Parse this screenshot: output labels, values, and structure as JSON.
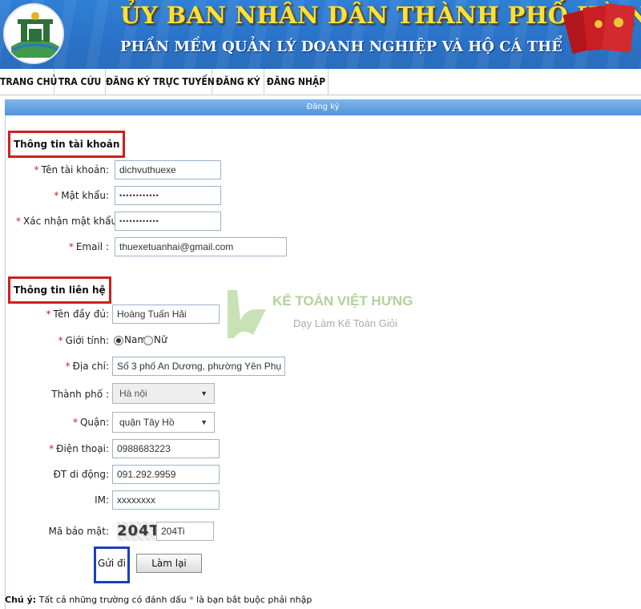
{
  "header": {
    "title": "ỦY BAN NHÂN DÂN THÀNH PHỐ HÀ NỘI",
    "subtitle": "PHẦN MỀM QUẢN LÝ DOANH NGHIỆP VÀ HỘ CÁ THỂ"
  },
  "nav": {
    "items": [
      {
        "label": "TRANG CHỦ"
      },
      {
        "label": "TRA CỨU"
      },
      {
        "label": "ĐĂNG KÝ TRỰC TUYẾN"
      },
      {
        "label": "ĐĂNG KÝ"
      },
      {
        "label": "ĐĂNG NHẬP"
      }
    ]
  },
  "section_title": "Đăng ký",
  "account": {
    "heading": "Thông tin tài khoản",
    "username": {
      "label": "Tên tài khoản:",
      "value": "dichvuthuexe"
    },
    "password": {
      "label": "Mật khẩu:",
      "value": "••••••••••••"
    },
    "confirm_password": {
      "label": "Xác nhận mật khẩu:",
      "value": "••••••••••••"
    },
    "email": {
      "label": "Email :",
      "value": "thuexetuanhai@gmail.com"
    }
  },
  "contact": {
    "heading": "Thông tin liên hệ",
    "fullname": {
      "label": "Tên đầy đủ:",
      "value": "Hoàng Tuấn Hải"
    },
    "gender": {
      "label": "Giới tính:",
      "options": [
        "Nam",
        "Nữ"
      ],
      "selected": "Nam"
    },
    "address": {
      "label": "Địa chỉ:",
      "value": "Số 3 phố An Dương, phường Yên Phụ"
    },
    "city": {
      "label": "Thành phố :",
      "value": "Hà nội"
    },
    "district": {
      "label": "Quận:",
      "value": "quận Tây Hồ"
    },
    "phone": {
      "label": "Điện thoại:",
      "value": "0988683223"
    },
    "office_phone": {
      "label": "ĐT di động:",
      "value": "091.292.9959"
    },
    "im": {
      "label": "IM:",
      "value": "xxxxxxxx"
    },
    "captcha": {
      "label": "Mã bảo mật:",
      "image_text": "204Ti",
      "value": "204Ti"
    }
  },
  "buttons": {
    "submit": "Gửi đi",
    "reset": "Làm lại"
  },
  "note": {
    "prefix": "Chú ý:",
    "text_before": " Tất cả những trường có đánh dấu ",
    "star": "*",
    "text_after": " là bạn bắt buộc phải nhập"
  },
  "watermark": {
    "brand": "KẾ TOÁN VIỆT HƯNG",
    "slogan": "Dạy Làm Kế Toán Giỏi"
  },
  "colors": {
    "banner_blue": "#2a73c8",
    "title_yellow": "#ffe135",
    "highlight_red": "#cf1f1f",
    "highlight_blue": "#1a3fbf",
    "required_star": "#cf1f1f"
  }
}
